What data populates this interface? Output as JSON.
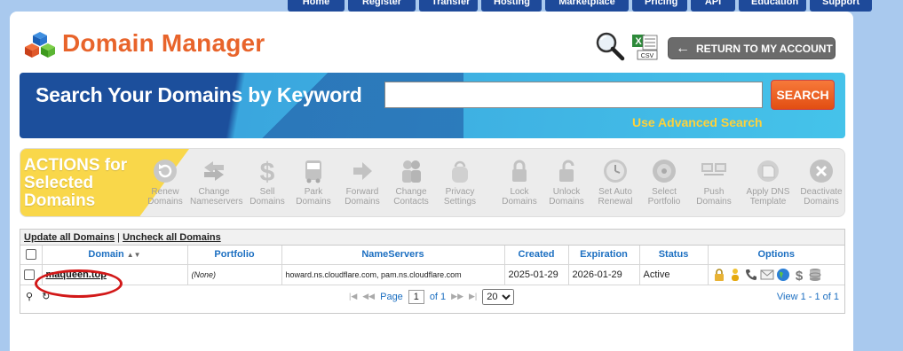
{
  "top_nav": {
    "tabs": [
      "Home",
      "Register",
      "Transfer",
      "Hosting",
      "Marketplace",
      "Pricing",
      "API",
      "Education",
      "Support"
    ]
  },
  "header": {
    "title": "Domain Manager",
    "return_button": "RETURN TO MY ACCOUNT"
  },
  "search": {
    "label": "Search Your Domains by Keyword",
    "input_value": "",
    "submit_label": "SEARCH",
    "advanced_link": "Use Advanced Search"
  },
  "actions": {
    "title_line1": "ACTIONS for",
    "title_line2": "Selected",
    "title_line3": "Domains",
    "items": [
      {
        "l1": "Renew",
        "l2": "Domains",
        "icon": "refresh-icon"
      },
      {
        "l1": "Change",
        "l2": "Nameservers",
        "icon": "swap-arrows-icon"
      },
      {
        "l1": "Sell",
        "l2": "Domains",
        "icon": "dollar-icon"
      },
      {
        "l1": "Park",
        "l2": "Domains",
        "icon": "bus-icon"
      },
      {
        "l1": "Forward",
        "l2": "Domains",
        "icon": "forward-arrow-icon"
      },
      {
        "l1": "Change",
        "l2": "Contacts",
        "icon": "people-icon"
      },
      {
        "l1": "Privacy",
        "l2": "Settings",
        "icon": "privacy-bag-icon"
      },
      {
        "l1": "Lock",
        "l2": "Domains",
        "icon": "lock-icon"
      },
      {
        "l1": "Unlock",
        "l2": "Domains",
        "icon": "unlock-icon"
      },
      {
        "l1": "Set Auto",
        "l2": "Renewal",
        "icon": "clock-icon"
      },
      {
        "l1": "Select",
        "l2": "Portfolio",
        "icon": "disc-icon"
      },
      {
        "l1": "Push",
        "l2": "Domains",
        "icon": "monitors-icon"
      },
      {
        "l1": "Apply DNS",
        "l2": "Template",
        "icon": "dns-template-icon"
      },
      {
        "l1": "Deactivate",
        "l2": "Domains",
        "icon": "deactivate-x-icon"
      }
    ]
  },
  "grid": {
    "toolbar": {
      "update_all": "Update all Domains",
      "separator": "|",
      "uncheck_all": "Uncheck all Domains"
    },
    "columns": [
      "Domain",
      "Portfolio",
      "NameServers",
      "Created",
      "Expiration",
      "Status",
      "Options"
    ],
    "rows": [
      {
        "domain": "maqueen.top",
        "portfolio": "(None)",
        "nameservers": "howard.ns.cloudflare.com, pam.ns.cloudflare.com",
        "created": "2025-01-29",
        "expiration": "2026-01-29",
        "status": "Active"
      }
    ],
    "pager": {
      "page_label": "Page",
      "page_value": "1",
      "of_label": "of 1",
      "page_size": "20",
      "view_count": "View 1 - 1 of 1"
    }
  }
}
